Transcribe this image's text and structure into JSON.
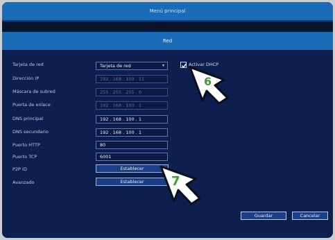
{
  "window": {
    "title": "Menú principal"
  },
  "section": {
    "title": "Red"
  },
  "form": {
    "rows": [
      {
        "label": "Tarjeta de red",
        "value": "Tarjeta de red",
        "type": "select",
        "disabled": false
      },
      {
        "label": "Dirección IP",
        "value": "192 . 168 . 100 . 11",
        "type": "ip",
        "disabled": true
      },
      {
        "label": "Máscara de subred",
        "value": "255 . 255 . 255 . 0",
        "type": "ip",
        "disabled": true
      },
      {
        "label": "Puerta de enlace",
        "value": "192 . 168 . 100 . 1",
        "type": "ip",
        "disabled": true
      },
      {
        "label": "DNS principal",
        "value": "192 . 168 . 100 . 1",
        "type": "ip",
        "disabled": false
      },
      {
        "label": "DNS secundario",
        "value": "192 . 168 . 100 . 1",
        "type": "ip",
        "disabled": false
      },
      {
        "label": "Puerto HTTP",
        "value": "80",
        "type": "text",
        "disabled": false
      },
      {
        "label": "Puerto TCP",
        "value": "6001",
        "type": "text",
        "disabled": false
      },
      {
        "label": "P2P ID",
        "value": "Establecer",
        "type": "button",
        "disabled": false
      },
      {
        "label": "Avanzado",
        "value": "Establecer",
        "type": "button",
        "disabled": false
      }
    ],
    "dhcp": {
      "label": "Activar DHCP",
      "checked": true
    }
  },
  "actions": {
    "save": "Guardar",
    "cancel": "Cancelar"
  },
  "callouts": {
    "first": "6",
    "second": "7"
  },
  "colors": {
    "callout": "#3e9c35",
    "title_bar": "#1a6bb8",
    "panel": "#0c1f4e"
  }
}
